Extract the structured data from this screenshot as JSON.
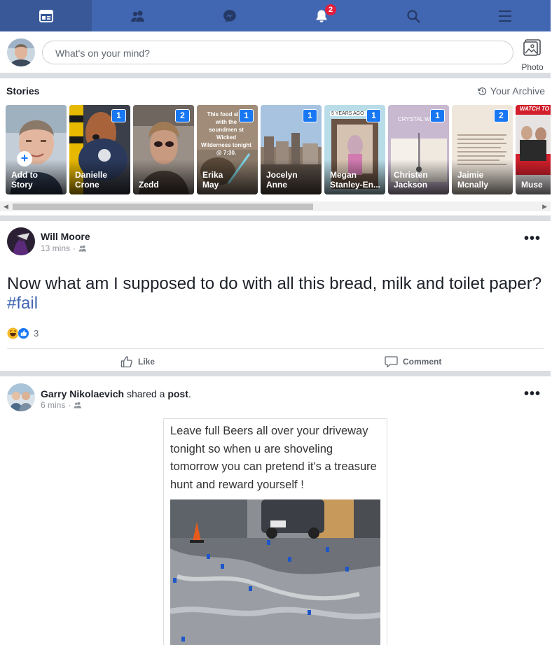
{
  "nav": {
    "tabs": [
      {
        "name": "news-feed",
        "icon": "news-feed-icon",
        "active": true
      },
      {
        "name": "friends",
        "icon": "friends-icon"
      },
      {
        "name": "messenger",
        "icon": "messenger-icon"
      },
      {
        "name": "notifications",
        "icon": "bell-icon",
        "badge": "2"
      },
      {
        "name": "search",
        "icon": "search-icon"
      },
      {
        "name": "menu",
        "icon": "hamburger-menu-icon"
      }
    ]
  },
  "composer": {
    "placeholder": "What's on your mind?",
    "photo_label": "Photo"
  },
  "stories": {
    "title": "Stories",
    "archive_label": "Your Archive",
    "items": [
      {
        "line1": "Add to",
        "line2": "Story",
        "count": ""
      },
      {
        "line1": "Danielle",
        "line2": "Crone",
        "count": "1"
      },
      {
        "line1": "Zedd",
        "line2": "",
        "count": "2"
      },
      {
        "line1": "Erika",
        "line2": "May",
        "count": "1"
      },
      {
        "line1": "Jocelyn",
        "line2": "Anne",
        "count": "1"
      },
      {
        "line1": "Megan",
        "line2": "Stanley-En...",
        "count": "1"
      },
      {
        "line1": "Christen",
        "line2": "Jackson",
        "count": "1"
      },
      {
        "line1": "Jaimie",
        "line2": "Mcnally",
        "count": "2"
      },
      {
        "line1": "Muse",
        "line2": "",
        "count": ""
      }
    ],
    "card_texts": {
      "erika": "This food sing with the soundmen st Wicked Wilderness tonight @ 7:30.",
      "megan": "5 YEARS AGO",
      "christen": "CRYSTAL WI",
      "muse": "WATCH TO"
    }
  },
  "post1": {
    "author": "Will Moore",
    "time": "13 mins",
    "text": "Now what am I supposed to do with all this bread, milk and toilet paper?",
    "hashtag": "#fail",
    "reaction_count": "3",
    "like_label": "Like",
    "comment_label": "Comment"
  },
  "post2": {
    "author": "Garry Nikolaevich",
    "shared_word": "shared a",
    "post_word": "post",
    "period": ".",
    "time": "6 mins",
    "shared_text": "Leave full Beers all over your driveway tonight so when u are shoveling tomorrow you can pretend it's a treasure hunt and reward yourself !"
  },
  "colors": {
    "brand": "#4267b2",
    "nav_active": "#385898",
    "badge": "#e41e3f",
    "story_count": "#1877f2",
    "separator": "#dadde1"
  }
}
